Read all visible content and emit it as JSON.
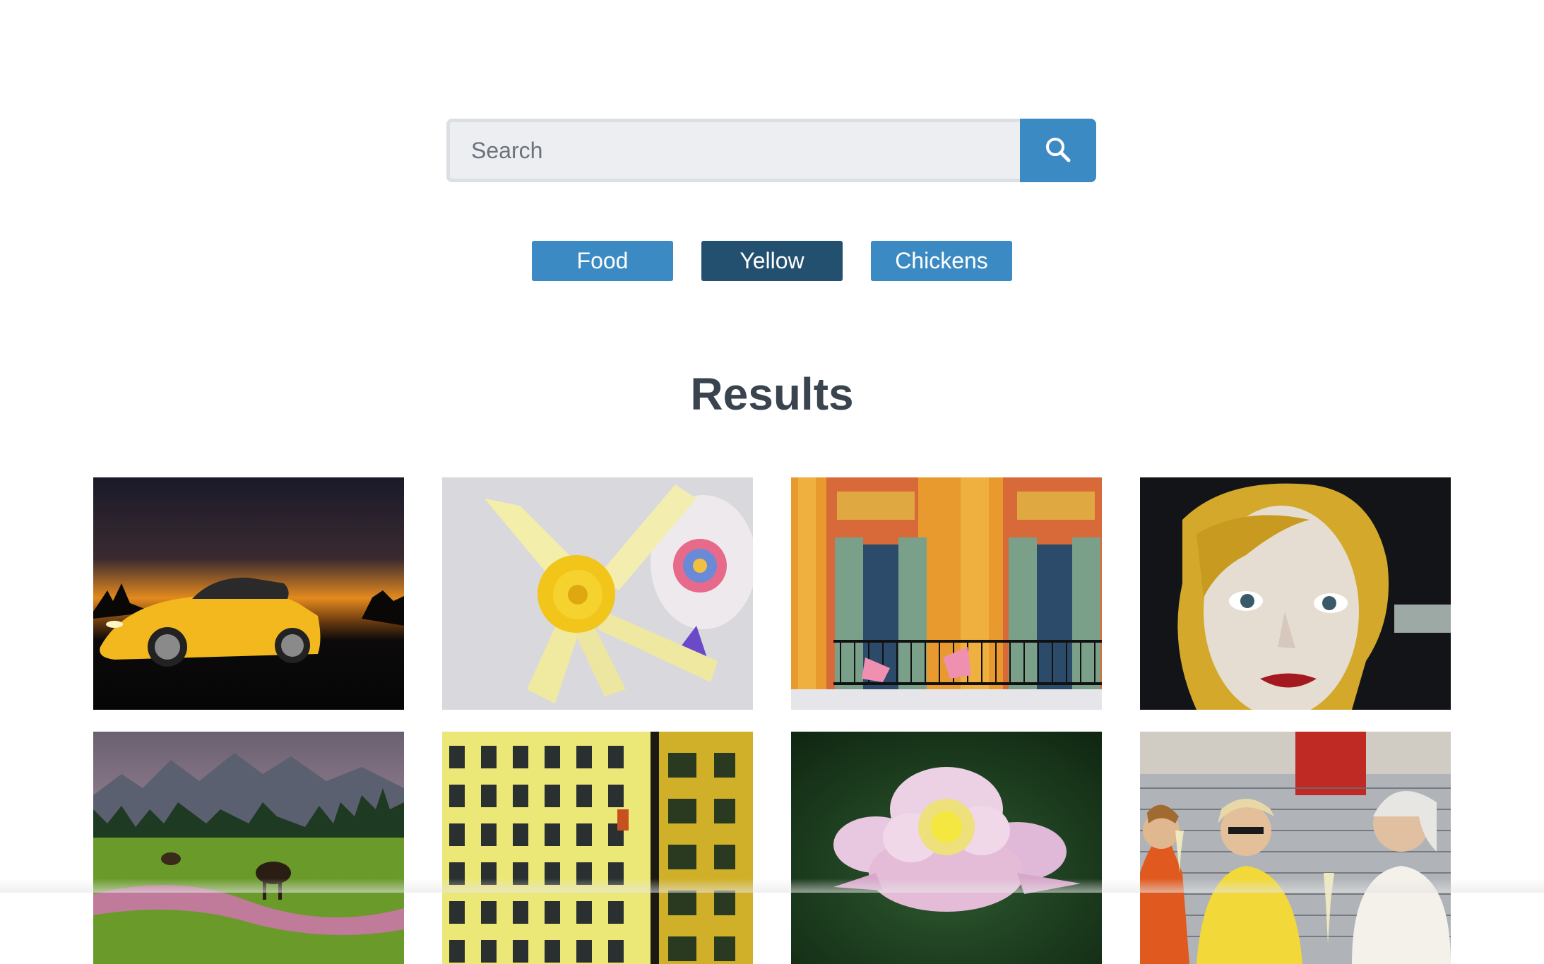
{
  "search": {
    "placeholder": "Search",
    "value": "",
    "icon": "search-icon",
    "accent_color": "#3b8ac3"
  },
  "tags": [
    {
      "label": "Food",
      "active": false
    },
    {
      "label": "Yellow",
      "active": true
    },
    {
      "label": "Chickens",
      "active": false
    }
  ],
  "tag_colors": {
    "default": "#3b8ac3",
    "active": "#24506f"
  },
  "results": {
    "title": "Results",
    "images": [
      "yellow-sports-car-at-sunset",
      "yellow-daffodil-flower",
      "orange-building-facade-with-balcony",
      "woman-with-blonde-hair-portrait",
      "moose-in-mountain-meadow",
      "yellow-apartment-building-windows",
      "pink-peony-flower",
      "women-drinking-wine-outdoors"
    ]
  }
}
